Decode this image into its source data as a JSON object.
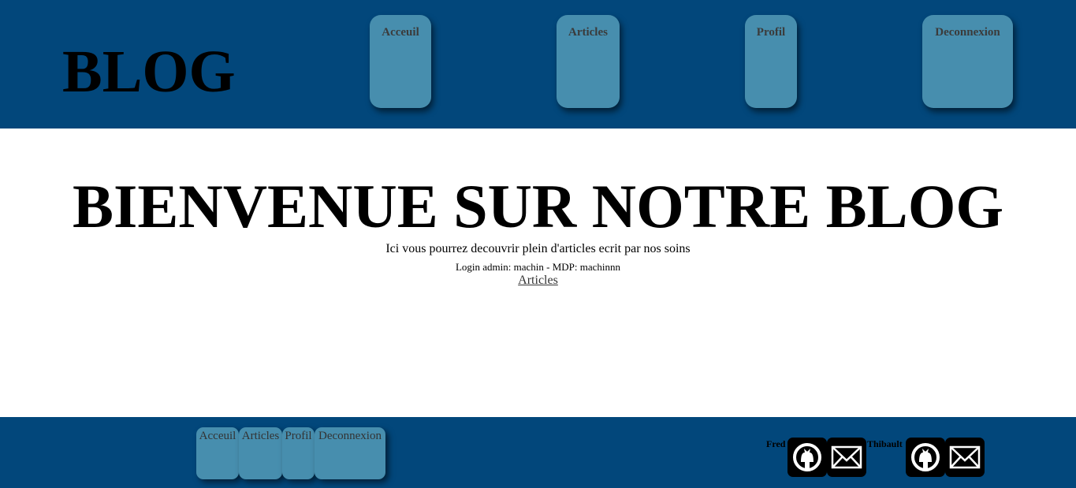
{
  "header": {
    "logo": "BLOG",
    "nav": [
      "Acceuil",
      "Articles",
      "Profil",
      "Deconnexion"
    ]
  },
  "hero": {
    "title": "BIENVENUE SUR NOTRE BLOG",
    "subtitle": "Ici vous pourrez decouvrir plein d'articles ecrit par nos soins",
    "login_info": "Login admin: machin - MDP: machinnn",
    "link": "Articles"
  },
  "footer": {
    "nav": [
      "Acceuil",
      "Articles",
      "Profil",
      "Deconnexion"
    ],
    "authors": [
      {
        "name": "Fred",
        "icons": [
          "github-icon",
          "mail-icon"
        ]
      },
      {
        "name": "Thibault",
        "icons": [
          "github-icon",
          "mail-icon"
        ]
      }
    ]
  },
  "colors": {
    "bar": "#02477b",
    "button": "#478eae"
  }
}
